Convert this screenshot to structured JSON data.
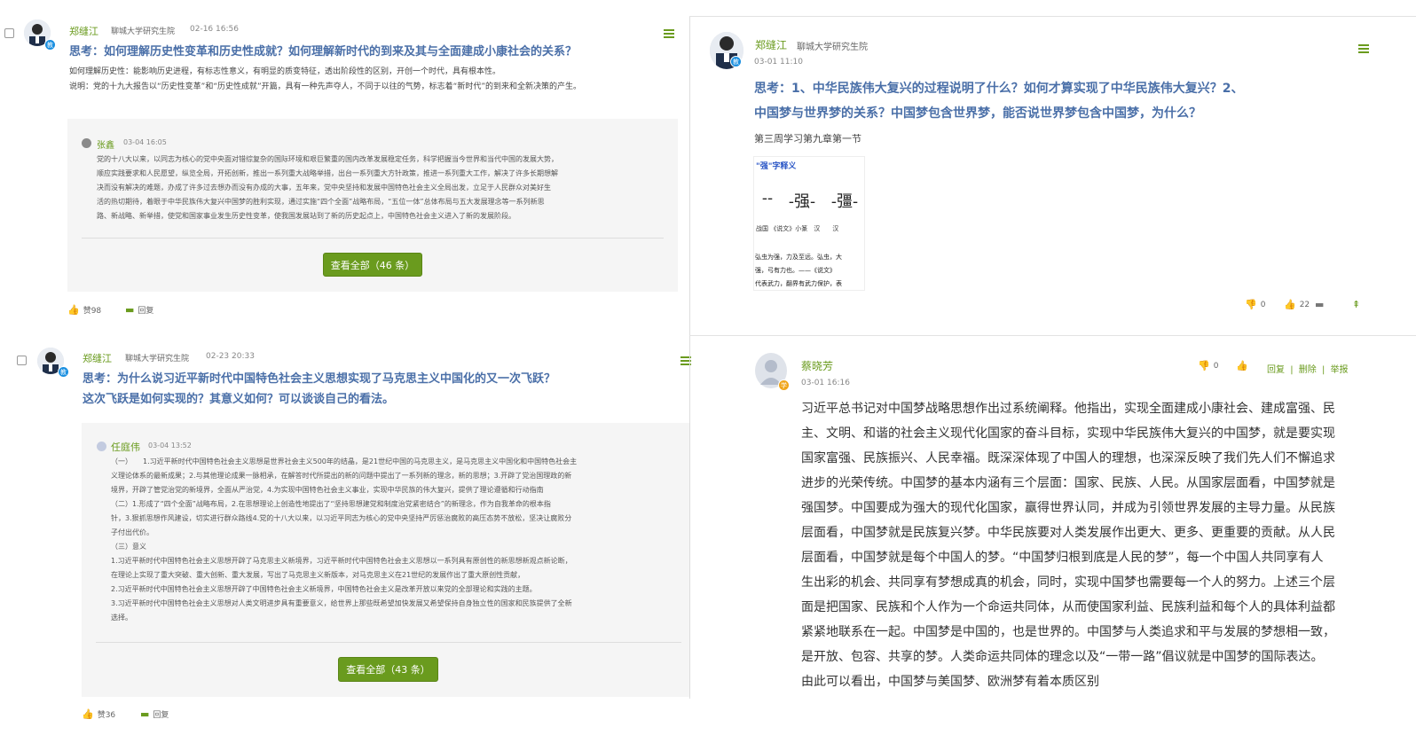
{
  "post1": {
    "author": "郑缝江",
    "org": "聊城大学研究生院",
    "time": "02-16 16:56",
    "badge": "教",
    "title": "思考：如何理解历史性变革和历史性成就？如何理解新时代的到来及其与全面建成小康社会的关系？",
    "body_line1": "如何理解历史性：能影响历史进程，有标志性意义，有明显的质变特征，透出阶段性的区别，开创一个时代，具有根本性。",
    "body_line2": "说明：党的十九大报告以“历史性变革”和“历史性成就”开篇，具有一种先声夺人，不同于以往的气势，标志着“新时代”的到来和全新决策的产生。",
    "reply": {
      "author": "张鑫",
      "time": "03-04 16:05",
      "lines": [
        "党的十八大以来，以同志为核心的党中央面对错综复杂的国际环境和艰巨繁重的国内改革发展稳定任务，科学把握当今世界和当代中国的发展大势，",
        "顺应实践要求和人民愿望，纵览全局，开拓创新，推出一系列重大战略举措，出台一系列重大方针政策，推进一系列重大工作，解决了许多长期想解",
        "决而没有解决的难题，办成了许多过去想办而没有办成的大事，五年来，党中央坚持和发展中国特色社会主义全局出发，立足于人民群众对美好生",
        "活的热切期待，着眼于中华民族伟大复兴中国梦的胜利实现，通过实施“四个全面”战略布局，“五位一体”总体布局与五大发展理念等一系列新思",
        "路、新战略、新举措，使党和国家事业发生历史性变革，使我国发展站到了新的历史起点上，中国特色社会主义进入了新的发展阶段。"
      ]
    },
    "view_all": "查看全部（46 条）",
    "likes": "赞98",
    "reply_label": "回复"
  },
  "post2": {
    "author": "郑缝江",
    "org": "聊城大学研究生院",
    "time": "02-23 20:33",
    "badge": "教",
    "title_line1": "思考：为什么说习近平新时代中国特色社会主义思想实现了马克思主义中国化的又一次飞跃？",
    "title_line2": "这次飞跃是如何实现的？其意义如何？可以谈谈自己的看法。",
    "reply": {
      "author": "任庭伟",
      "time": "03-04 13:52",
      "lines": [
        "（一）　　1.习近平新时代中国特色社会主义思想是世界社会主义500年的结晶，是21世纪中国的马克思主义，是马克思主义中国化和中国特色社会主",
        "义理论体系的最新成果；2.与其他理论成果一脉相承，在解答时代所提出的新的问题中提出了一系列新的理念，新的思想；3.开辟了党治国理政的新",
        "境界，开辟了管党治党的新境界，全面从严治党，4.为实现中国特色社会主义事业，实现中华民族的伟大复兴，提供了理论遵循和行动指南",
        "（二）1.形成了“四个全面”战略布局，2.在思想理论上创造性地提出了“坚持思想建党和制度治党紧密结合”的新理念，作为自我革命的根本指",
        "针，3.狠抓思想作风建设，切实进行群众路线4.党的十八大以来，以习近平同志为核心的党中央坚持严厉惩治腐败的高压态势不放松，坚决让腐败分",
        "子付出代价。",
        "（三）意义",
        "1.习近平新时代中国特色社会主义思想开辟了马克思主义新境界，习近平新时代中国特色社会主义思想以一系列具有原创性的新思想新观点新论断，",
        "在理论上实现了重大突破、重大创新、重大发展，写出了马克思主义新版本，对马克思主义在21世纪的发展作出了重大原创性贡献，",
        "2.习近平新时代中国特色社会主义思想开辟了中国特色社会主义新境界，中国特色社会主义是改革开放以来党的全部理论和实践的主题。",
        "3.习近平新时代中国特色社会主义思想对人类文明进步具有重要意义，给世界上那些既希望加快发展又希望保持自身独立性的国家和民族提供了全新",
        "选择。"
      ]
    },
    "view_all": "查看全部（43 条）",
    "likes": "赞36",
    "reply_label": "回复"
  },
  "right_post": {
    "author": "郑缝江",
    "org": "聊城大学研究生院",
    "time": "03-01 11:10",
    "badge": "教",
    "title_line1": "思考：1、中华民族伟大复兴的过程说明了什么？如何才算实现了中华民族伟大复兴？2、",
    "title_line2": "中国梦与世界梦的关系？中国梦包含世界梦，能否说世界梦包含中国梦，为什么？",
    "subtitle": "第三周学习第九章第一节",
    "image": {
      "header": "\"强\"字释义",
      "glyphs": [
        "-𢎘-",
        "-强-",
        "-彊-",
        "-强-"
      ],
      "glyph_labels": "战国 《说文》小篆　汉　　汉",
      "caption_line1": "弘虫为强，力及至远。弘虫，大",
      "caption_line2": "强，弓有力也。——《说文》",
      "caption_line3": "代表武力，翻界有武力保护，表"
    },
    "dislikes": "0",
    "likes": "22"
  },
  "comment": {
    "author": "蔡晓芳",
    "time": "03-01 16:16",
    "badge": "学",
    "dislikes": "0",
    "links": [
      "回复",
      "删除",
      "举报"
    ],
    "lines": [
      "习近平总书记对中国梦战略思想作出过系统阐释。他指出，实现全面建成小康社会、建成富强、民",
      "主、文明、和谐的社会主义现代化国家的奋斗目标，实现中华民族伟大复兴的中国梦，就是要实现",
      "国家富强、民族振兴、人民幸福。既深深体现了中国人的理想，也深深反映了我们先人们不懈追求",
      "进步的光荣传统。中国梦的基本内涵有三个层面：国家、民族、人民。从国家层面看，中国梦就是",
      "强国梦。中国要成为强大的现代化国家，赢得世界认同，并成为引领世界发展的主导力量。从民族",
      "层面看，中国梦就是民族复兴梦。中华民族要对人类发展作出更大、更多、更重要的贡献。从人民",
      "层面看，中国梦就是每个中国人的梦。“中国梦归根到底是人民的梦”，每一个中国人共同享有人",
      "生出彩的机会、共同享有梦想成真的机会，同时，实现中国梦也需要每一个人的努力。上述三个层",
      "面是把国家、民族和个人作为一个命运共同体，从而使国家利益、民族利益和每个人的具体利益都",
      "紧紧地联系在一起。中国梦是中国的，也是世界的。中国梦与人类追求和平与发展的梦想相一致，",
      "是开放、包容、共享的梦。人类命运共同体的理念以及“一带一路”倡议就是中国梦的国际表达。",
      "由此可以看出，中国梦与美国梦、欧洲梦有着本质区别"
    ]
  }
}
